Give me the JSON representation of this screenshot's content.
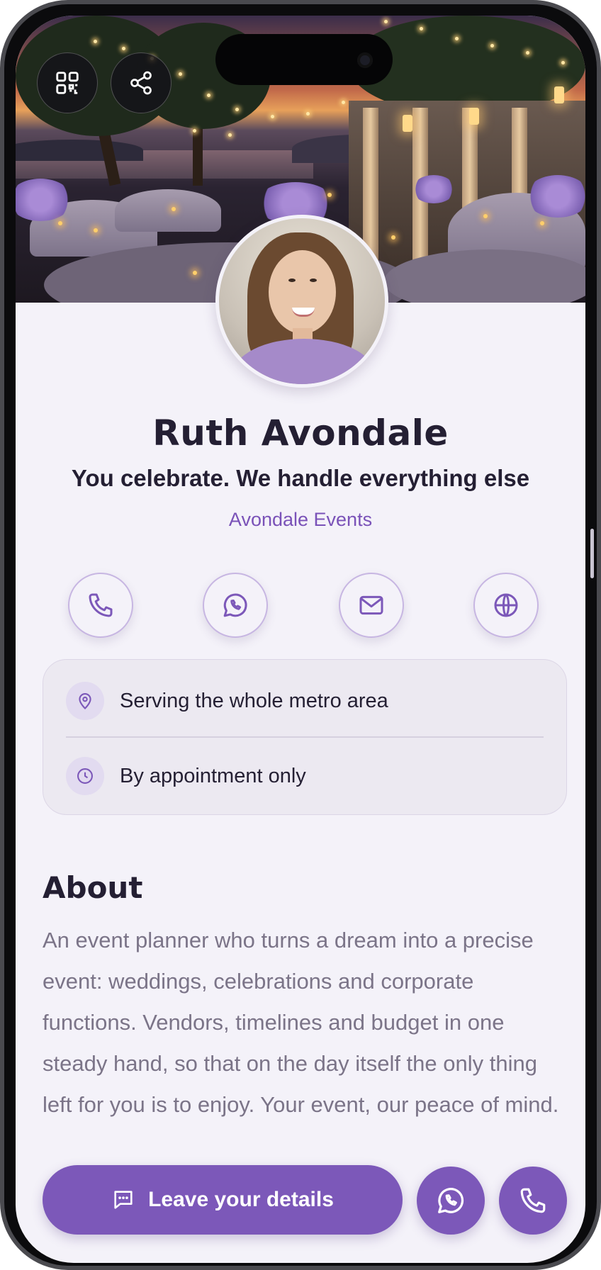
{
  "hero": {
    "image": "event-venue-sunset-photo",
    "qr_button": {
      "icon": "qr-code-icon"
    },
    "share_button": {
      "icon": "share-icon"
    }
  },
  "profile": {
    "avatar": "profile-photo",
    "name": "Ruth Avondale",
    "tagline": "You celebrate. We handle everything else",
    "company": "Avondale Events"
  },
  "actions": [
    {
      "name": "call",
      "icon": "phone-icon"
    },
    {
      "name": "whatsapp",
      "icon": "whatsapp-icon"
    },
    {
      "name": "email",
      "icon": "mail-icon"
    },
    {
      "name": "website",
      "icon": "globe-icon"
    }
  ],
  "info": {
    "location": {
      "icon": "map-pin-icon",
      "text": "Serving the whole metro area"
    },
    "hours": {
      "icon": "clock-icon",
      "text": "By appointment only"
    }
  },
  "about": {
    "heading": "About",
    "text": "An event planner who turns a dream into a precise event: weddings, celebrations and corporate functions. Vendors, timelines and budget in one steady hand, so that on the day itself the only thing left for you is to enjoy. Your event, our peace of mind."
  },
  "bottom_bar": {
    "cta_label": "Leave your details",
    "cta_icon": "message-icon",
    "whatsapp_icon": "whatsapp-icon",
    "phone_icon": "phone-icon"
  },
  "colors": {
    "accent": "#7c58b9",
    "text_dark": "#241f33",
    "text_muted": "#7b7488",
    "background": "#f4f2f9"
  }
}
